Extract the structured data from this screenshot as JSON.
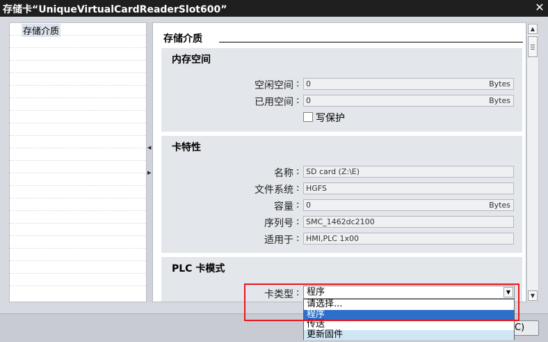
{
  "window": {
    "title": "存储卡“UniqueVirtualCardReaderSlot600”",
    "close_icon": "close-icon"
  },
  "nav": {
    "items": [
      {
        "label": "存储介质"
      }
    ]
  },
  "main": {
    "section_title": "存储介质",
    "memory": {
      "title": "内存空间",
      "free_label": "空闲空间",
      "free_value": "0",
      "free_unit": "Bytes",
      "used_label": "已用空间",
      "used_value": "0",
      "used_unit": "Bytes",
      "write_protect_label": "写保护"
    },
    "card": {
      "title": "卡特性",
      "name_label": "名称",
      "name_value": "SD card (Z:\\E)",
      "fs_label": "文件系统",
      "fs_value": "HGFS",
      "capacity_label": "容量",
      "capacity_value": "0",
      "capacity_unit": "Bytes",
      "serial_label": "序列号",
      "serial_value": "SMC_1462dc2100",
      "applies_label": "适用于",
      "applies_value": "HMI,PLC 1x00"
    },
    "plc": {
      "title": "PLC 卡模式",
      "type_label": "卡类型",
      "type_value": "程序",
      "options": [
        "请选择...",
        "程序",
        "传送",
        "更新固件"
      ],
      "selected_index": 1
    }
  },
  "footer": {
    "ok_label": "C)"
  },
  "colon": ":"
}
